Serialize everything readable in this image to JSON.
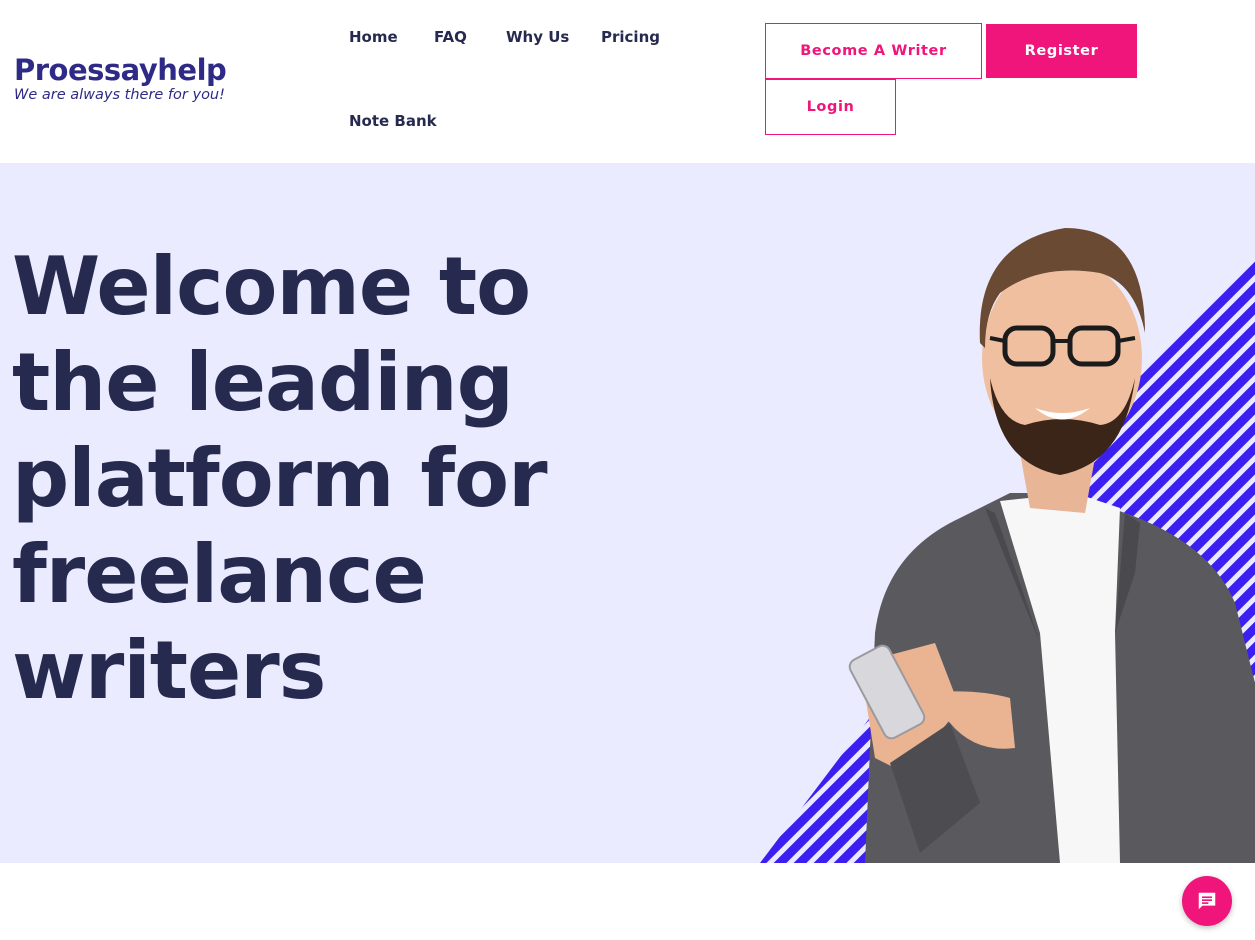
{
  "brand": {
    "name": "Proessayhelp",
    "tagline": "We are always there for you!",
    "color": "#2e2a86"
  },
  "nav": {
    "items": [
      {
        "label": "Home"
      },
      {
        "label": "FAQ"
      },
      {
        "label": "Why Us"
      },
      {
        "label": "Pricing"
      },
      {
        "label": "Note Bank"
      }
    ]
  },
  "actions": {
    "become_writer": "Become A Writer",
    "register": "Register",
    "login": "Login",
    "accent": "#f0157a"
  },
  "hero": {
    "lines": [
      "Welcome to",
      "the leading",
      "platform for",
      "freelance",
      "writers"
    ],
    "background": "#ebebff",
    "stripe_color": "#3b1ff0",
    "image": "smiling-man-with-phone"
  },
  "chat": {
    "icon": "chat-bubble-icon"
  }
}
